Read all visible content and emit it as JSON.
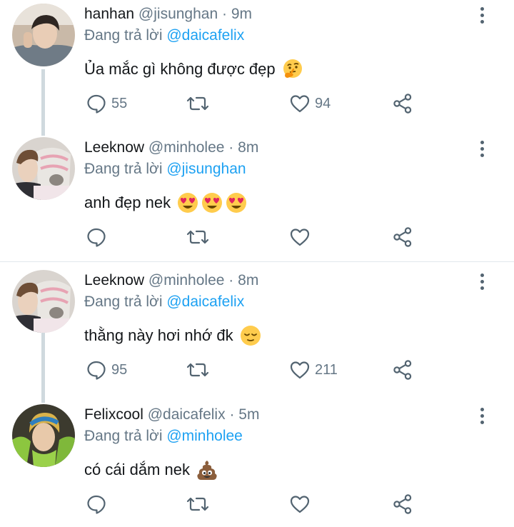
{
  "tweets": [
    {
      "name": "hanhan",
      "handle": "@jisunghan",
      "dot": "·",
      "time": "9m",
      "reply_prefix": "Đang trả lời",
      "reply_to": "@daicafelix",
      "text": "Ủa mắc gì không được đẹp",
      "emojis": [
        "thinking-face"
      ],
      "reply_count": "55",
      "retweet_count": "",
      "like_count": "94"
    },
    {
      "name": "Leeknow",
      "handle": "@minholee",
      "dot": "·",
      "time": "8m",
      "reply_prefix": "Đang trả lời",
      "reply_to": "@jisunghan",
      "text": "anh đẹp nek",
      "emojis": [
        "heart-eyes",
        "heart-eyes",
        "heart-eyes"
      ],
      "reply_count": "",
      "retweet_count": "",
      "like_count": ""
    },
    {
      "name": "Leeknow",
      "handle": "@minholee",
      "dot": "·",
      "time": "8m",
      "reply_prefix": "Đang trả lời",
      "reply_to": "@daicafelix",
      "text": "thằng này hơi nhớ đk",
      "emojis": [
        "relieved-face"
      ],
      "reply_count": "95",
      "retweet_count": "",
      "like_count": "211"
    },
    {
      "name": "Felixcool",
      "handle": "@daicafelix",
      "dot": "·",
      "time": "5m",
      "reply_prefix": "Đang trả lời",
      "reply_to": "@minholee",
      "text": "có cái dắm nek",
      "emojis": [
        "pile-of-poo"
      ],
      "reply_count": "",
      "retweet_count": "",
      "like_count": ""
    }
  ],
  "colors": {
    "link": "#1da1f2",
    "secondary_text": "#657786",
    "icon": "#536471",
    "thread_line": "#cfd9de"
  }
}
